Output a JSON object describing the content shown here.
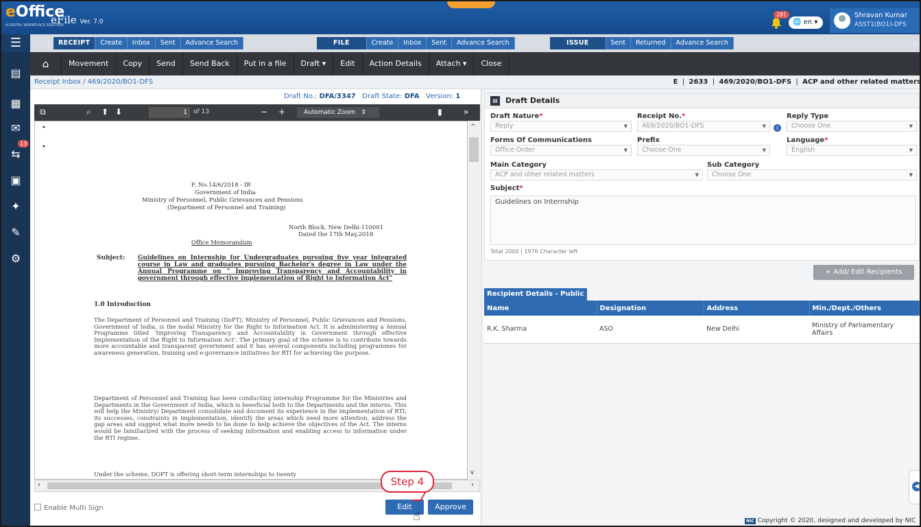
{
  "header": {
    "logo_text": "eOffice",
    "logo_tagline": "A DIGITAL WORKPLACE SOLUTION",
    "app_name": "eFile",
    "version": "Ver. 7.0",
    "notification_count": "281",
    "language": "en",
    "user_name": "Shravan Kumar",
    "user_role": "ASST1(BO1)-DFS"
  },
  "tabbar": {
    "receipt": {
      "head": "RECEIPT",
      "items": [
        "Create",
        "Inbox",
        "Sent",
        "Advance Search"
      ]
    },
    "file": {
      "head": "FILE",
      "items": [
        "Create",
        "Inbox",
        "Sent",
        "Advance Search"
      ]
    },
    "issue": {
      "head": "ISSUE",
      "items": [
        "Sent",
        "Returned",
        "Advance Search"
      ]
    }
  },
  "toolbar": {
    "items": [
      "Movement",
      "Copy",
      "Send",
      "Send Back",
      "Put in a file",
      "Draft ▾",
      "Edit",
      "Action Details",
      "Attach ▾",
      "Close"
    ]
  },
  "rail": {
    "badge": "13"
  },
  "breadcrumb": {
    "path": "Receipt Inbox  /  469/2020/BO1-DFS"
  },
  "file_ref": {
    "prefix": "E",
    "number": "2633",
    "receipt": "469/2020/BO1-DFS",
    "subject": "ACP and other related matters"
  },
  "draft": {
    "no_label": "Draft No.:",
    "no_value": "DFA/3347",
    "state_label": "Draft State:",
    "state_value": "DFA",
    "version_label": "Version:",
    "version_value": "1"
  },
  "pdf": {
    "page": "1",
    "of": "of 13",
    "zoom": "Automatic Zoom"
  },
  "document": {
    "head1": "F. No.14/6/2018 - IR",
    "head2": "Government of India",
    "head3": "Ministry of Personnel, Public Grievances and Pensions",
    "head4": "(Department of Personnel and Training)",
    "place": "North Block, New Delhi-110001",
    "date": "Dated the 17th May,2018",
    "memo": "Office Memorandum",
    "subject_label": "Subject:",
    "subject_text": "Guidelines on Internship for Undergraduates pursuing five year integrated course in Law and graduates pursuing Bachelor's degree in Law under the Annual Programme on \" Improving Transparency and Accountability in government through effective implementation of Right to Information Act\"",
    "intro_heading": "1.0 Introduction",
    "para1": "The Department of Personnel and Training (DoPT), Ministry of Personnel, Public Grievances and Pensions, Government of India, is the nodal Ministry for the Right to Information Act. It is administering a Annual Programme titled 'Improving Transparency and Accountability in Government through effective Implementation of the Right to Information Act'. The primary goal of the scheme is to contribute towards more accountable and transparent government and it has several components including programmes for awareness generation, training and e-governance initiatives for RTI for achieving the purpose.",
    "para2": "Department of Personnel and Training has been conducting internship Programme for the Ministries and Departments in the Government of India, which is beneficial both to the Departments and the interns. This will help the Ministry/ Department consolidate and document its experience in the implementation of RTI, its successes, constraints in implementation, identify the areas which need more attention, address the gap areas and suggest what more needs to be done to help achieve the objectives of the Act. The interns would be familiarized with the process of seeking information and enabling access to information under the RTI regime.",
    "para3": "Under the scheme, DOPT is offering short-term internships to twenty"
  },
  "left_footer": {
    "multi_sign": "Enable Multi Sign",
    "edit": "Edit",
    "approve": "Approve",
    "callout": "Step 4"
  },
  "draft_details": {
    "title": "Draft Details",
    "draft_nature": {
      "label": "Draft Nature",
      "value": "Reply"
    },
    "receipt_no": {
      "label": "Receipt No.",
      "value": "469/2020/BO1-DFS"
    },
    "reply_type": {
      "label": "Reply Type",
      "value": "Choose One"
    },
    "forms": {
      "label": "Forms Of Communications",
      "value": "Office Order"
    },
    "prefix": {
      "label": "Prefix",
      "value": "Choose One"
    },
    "language": {
      "label": "Language",
      "value": "English"
    },
    "main_category": {
      "label": "Main Category",
      "value": "ACP and other related matters"
    },
    "sub_category": {
      "label": "Sub Category",
      "value": "Choose One"
    },
    "subject": {
      "label": "Subject",
      "value": "Guidelines on Internship"
    },
    "char_count": "Total 2000 | 1976 Character left"
  },
  "recipients": {
    "add_button": "+ Add/ Edit Recipients",
    "tab_label": "Recipient Details - Public",
    "columns": [
      "Name",
      "Designation",
      "Address",
      "Min./Dept./Others"
    ],
    "rows": [
      {
        "name": "R.K. Sharma",
        "designation": "ASO",
        "address": "New Delhi",
        "ministry": "Ministry of Parliamentary Affairs"
      }
    ]
  },
  "footer": {
    "nic": "NIC",
    "copyright": "Copyright © 2020, designed and developed by NIC"
  }
}
